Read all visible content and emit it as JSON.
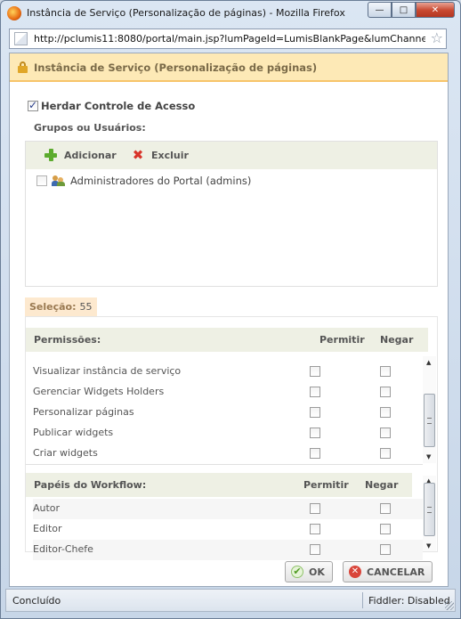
{
  "window": {
    "title": "Instância de Serviço (Personalização de páginas) - Mozilla Firefox",
    "minimize_glyph": "—",
    "maximize_glyph": "□",
    "close_glyph": "✕"
  },
  "address_bar": {
    "url": "http://pclumis11:8080/portal/main.jsp?lumPageId=LumisBlankPage&lumChannel"
  },
  "dialog": {
    "title": "Instância de Serviço (Personalização de páginas)",
    "inherit_access_label": "Herdar Controle de Acesso",
    "inherit_access_checked": true,
    "groups_label": "Grupos ou Usuários:",
    "toolbar": {
      "add_label": "Adicionar",
      "delete_label": "Excluir"
    },
    "principals": [
      {
        "label": "Administradores do Portal (admins)",
        "checked": false
      }
    ],
    "selection": {
      "label": "Seleção:",
      "value": "55"
    },
    "permissions": {
      "header": "Permissões:",
      "allow_header": "Permitir",
      "deny_header": "Negar",
      "rows": [
        {
          "label": "Visualizar instância de serviço"
        },
        {
          "label": "Gerenciar Widgets Holders"
        },
        {
          "label": "Personalizar páginas"
        },
        {
          "label": "Publicar widgets"
        },
        {
          "label": "Criar widgets"
        }
      ]
    },
    "workflow_roles": {
      "header": "Papéis do Workflow:",
      "allow_header": "Permitir",
      "deny_header": "Negar",
      "rows": [
        {
          "label": "Autor"
        },
        {
          "label": "Editor"
        },
        {
          "label": "Editor-Chefe"
        }
      ]
    },
    "ok_label": "OK",
    "cancel_label": "CANCELAR"
  },
  "statusbar": {
    "status": "Concluído",
    "fiddler": "Fiddler: Disabled"
  },
  "colors": {
    "header_bg": "#fde9b6",
    "section_bg": "#eef0e4",
    "selection_bg": "#fde9cf",
    "close_button": "#c8472f"
  }
}
